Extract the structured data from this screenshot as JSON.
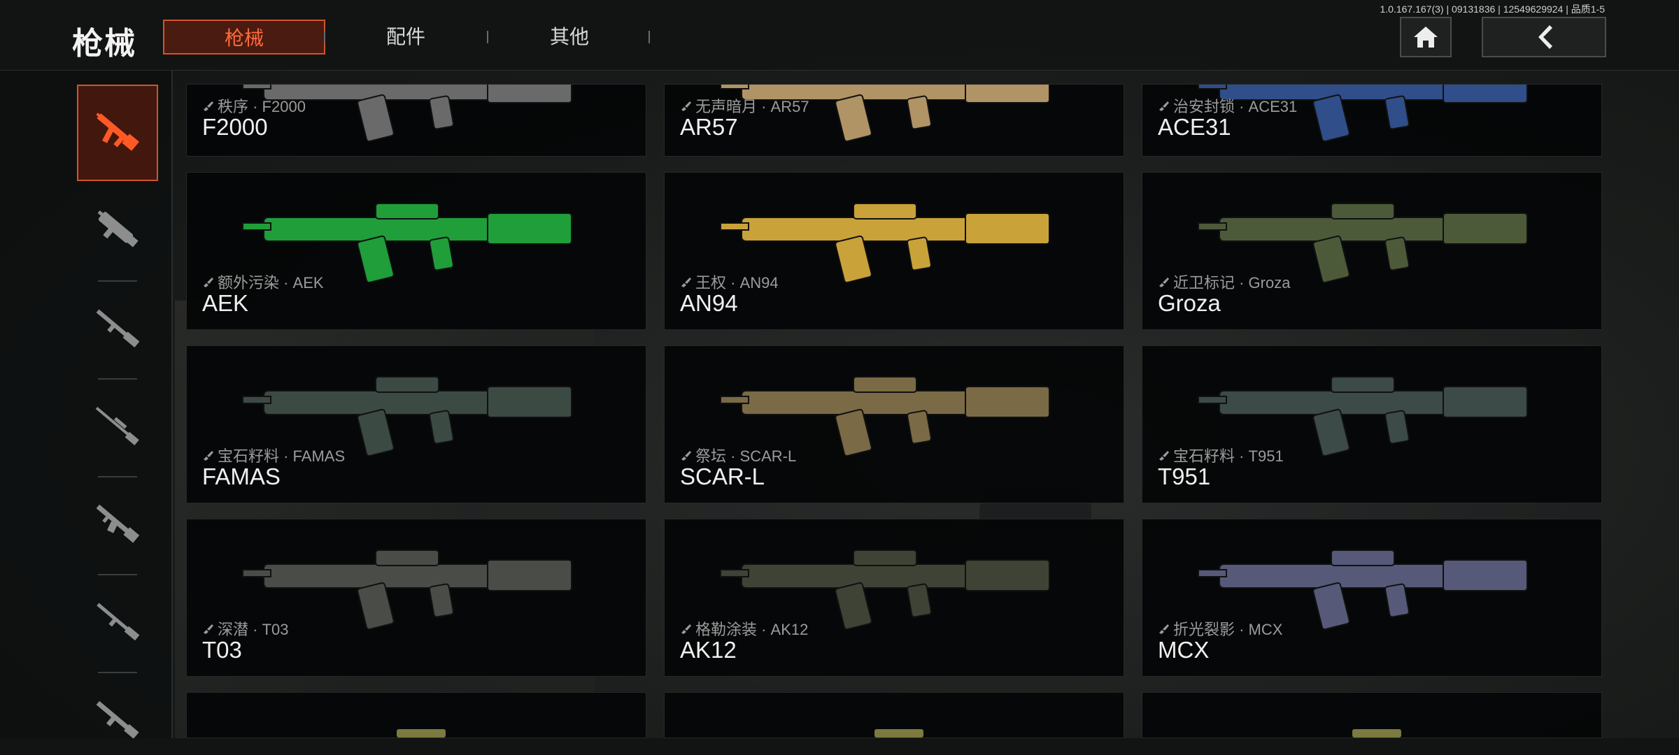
{
  "header": {
    "title": "枪械",
    "tabs": [
      {
        "label": "枪械",
        "active": true
      },
      {
        "label": "配件",
        "active": false
      },
      {
        "label": "其他",
        "active": false
      }
    ],
    "version": "1.0.167.167(3) | 09131836 | 12549629924 | 品质1-5",
    "home_icon": "home-icon",
    "back_icon": "chevron-left-icon"
  },
  "rail": {
    "items": [
      {
        "icon": "assault-rifle-icon",
        "active": true
      },
      {
        "icon": "smg-icon",
        "active": false
      },
      {
        "icon": "shotgun-icon",
        "active": false
      },
      {
        "icon": "sniper-rifle-icon",
        "active": false
      },
      {
        "icon": "lmg-icon",
        "active": false
      },
      {
        "icon": "marksman-rifle-icon",
        "active": false
      },
      {
        "icon": "rifle-icon",
        "active": false
      }
    ]
  },
  "weapons": [
    {
      "skin": "秩序 · F2000",
      "name": "F2000",
      "color": "#6a6a6a"
    },
    {
      "skin": "无声暗月 · AR57",
      "name": "AR57",
      "color": "#b09465"
    },
    {
      "skin": "治安封锁 · ACE31",
      "name": "ACE31",
      "color": "#2f4e8a"
    },
    {
      "skin": "额外污染 · AEK",
      "name": "AEK",
      "color": "#1f9e3a"
    },
    {
      "skin": "王权 · AN94",
      "name": "AN94",
      "color": "#c9a23a"
    },
    {
      "skin": "近卫标记 · Groza",
      "name": "Groza",
      "color": "#4c5a3a"
    },
    {
      "skin": "宝石籽料 · FAMAS",
      "name": "FAMAS",
      "color": "#3c4a44"
    },
    {
      "skin": "祭坛 · SCAR-L",
      "name": "SCAR-L",
      "color": "#7a6a46"
    },
    {
      "skin": "宝石籽料 · T951",
      "name": "T951",
      "color": "#3c4a48"
    },
    {
      "skin": "深潜 · T03",
      "name": "T03",
      "color": "#4a4c48"
    },
    {
      "skin": "格勒涂装 · AK12",
      "name": "AK12",
      "color": "#3f4336"
    },
    {
      "skin": "折光裂影 · MCX",
      "name": "MCX",
      "color": "#565a78"
    }
  ]
}
